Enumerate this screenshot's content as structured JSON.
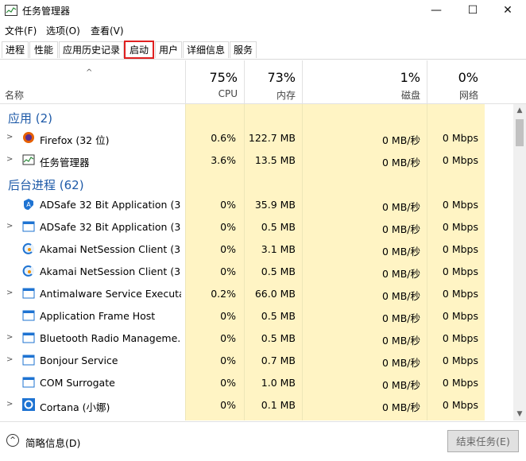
{
  "window": {
    "title": "任务管理器",
    "minimize": "—",
    "maximize": "☐",
    "close": "✕"
  },
  "menu": [
    "文件(F)",
    "选项(O)",
    "查看(V)"
  ],
  "tabs": [
    "进程",
    "性能",
    "应用历史记录",
    "启动",
    "用户",
    "详细信息",
    "服务"
  ],
  "header": {
    "name_label": "名称",
    "cpu": {
      "pct": "75%",
      "label": "CPU"
    },
    "mem": {
      "pct": "73%",
      "label": "内存"
    },
    "disk": {
      "pct": "1%",
      "label": "磁盘"
    },
    "net": {
      "pct": "0%",
      "label": "网络"
    }
  },
  "groups": {
    "apps": "应用 (2)",
    "background": "后台进程 (62)"
  },
  "apps": [
    {
      "name": "Firefox (32 位)",
      "cpu": "0.6%",
      "mem": "122.7 MB",
      "disk": "0 MB/秒",
      "net": "0 Mbps",
      "icon": "firefox-icon"
    },
    {
      "name": "任务管理器",
      "cpu": "3.6%",
      "mem": "13.5 MB",
      "disk": "0 MB/秒",
      "net": "0 Mbps",
      "icon": "task-manager-icon"
    }
  ],
  "background": [
    {
      "name": "ADSafe 32 Bit Application (3...",
      "cpu": "0%",
      "mem": "35.9 MB",
      "disk": "0 MB/秒",
      "net": "0 Mbps",
      "icon": "adsafe-icon"
    },
    {
      "name": "ADSafe 32 Bit Application (3...",
      "cpu": "0%",
      "mem": "0.5 MB",
      "disk": "0 MB/秒",
      "net": "0 Mbps",
      "icon": "app-window-icon"
    },
    {
      "name": "Akamai NetSession Client (3...",
      "cpu": "0%",
      "mem": "3.1 MB",
      "disk": "0 MB/秒",
      "net": "0 Mbps",
      "icon": "akamai-icon"
    },
    {
      "name": "Akamai NetSession Client (3...",
      "cpu": "0%",
      "mem": "0.5 MB",
      "disk": "0 MB/秒",
      "net": "0 Mbps",
      "icon": "akamai-icon"
    },
    {
      "name": "Antimalware Service Executa...",
      "cpu": "0.2%",
      "mem": "66.0 MB",
      "disk": "0 MB/秒",
      "net": "0 Mbps",
      "icon": "app-window-icon"
    },
    {
      "name": "Application Frame Host",
      "cpu": "0%",
      "mem": "0.5 MB",
      "disk": "0 MB/秒",
      "net": "0 Mbps",
      "icon": "app-window-icon"
    },
    {
      "name": "Bluetooth Radio Manageme...",
      "cpu": "0%",
      "mem": "0.5 MB",
      "disk": "0 MB/秒",
      "net": "0 Mbps",
      "icon": "app-window-icon"
    },
    {
      "name": "Bonjour Service",
      "cpu": "0%",
      "mem": "0.7 MB",
      "disk": "0 MB/秒",
      "net": "0 Mbps",
      "icon": "app-window-icon"
    },
    {
      "name": "COM Surrogate",
      "cpu": "0%",
      "mem": "1.0 MB",
      "disk": "0 MB/秒",
      "net": "0 Mbps",
      "icon": "app-window-icon"
    },
    {
      "name": "Cortana (小娜)",
      "cpu": "0%",
      "mem": "0.1 MB",
      "disk": "0 MB/秒",
      "net": "0 Mbps",
      "icon": "cortana-icon"
    }
  ],
  "footer": {
    "details_label": "简略信息(D)",
    "end_task": "结束任务(E)"
  },
  "colors": {
    "group_text": "#1e5aa8",
    "highlight_outline": "#e02020",
    "heat_light": "#fff4c4",
    "heat_medium": "#ffe9a8"
  }
}
